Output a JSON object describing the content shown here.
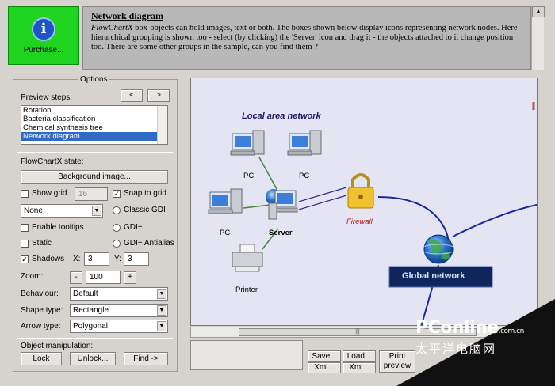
{
  "purchase": {
    "label": "Purchase...",
    "icon": "info-icon"
  },
  "description": {
    "title": "Network diagram",
    "brand": "FlowChartX",
    "text": "box-objects can hold images, text or both. The boxes shown below display icons representing network nodes. Here hierarchical grouping is shown too - select (by clicking) the 'Server' icon and drag it - the objects attached to it change position too. There are some other groups in the sample, can you find them ?"
  },
  "options": {
    "title": "Options",
    "preview_steps_label": "Preview steps:",
    "prev_label": "<",
    "next_label": ">",
    "steps": [
      "Rotation",
      "Bacteria classification",
      "Chemical synthesis tree",
      "Network diagram"
    ],
    "selected_step": "Network diagram",
    "state_label": "FlowChartX state:",
    "background_button": "Background image...",
    "show_grid": {
      "label": "Show grid",
      "checked": false,
      "value": "16"
    },
    "snap_to_grid": {
      "label": "Snap to grid",
      "checked": true
    },
    "grid_style": "None",
    "classic_gdi": "Classic GDI",
    "enable_tooltips": {
      "label": "Enable tooltips",
      "checked": false
    },
    "gdi_plus": "GDI+",
    "static": {
      "label": "Static",
      "checked": false
    },
    "gdi_plus_antialias": "GDI+ Antialias",
    "shadows": {
      "label": "Shadows",
      "checked": true
    },
    "x_label": "X:",
    "x_value": "3",
    "y_label": "Y:",
    "y_value": "3",
    "zoom_label": "Zoom:",
    "zoom_minus": "-",
    "zoom_value": "100",
    "zoom_plus": "+",
    "behaviour_label": "Behaviour:",
    "behaviour_value": "Default",
    "shape_label": "Shape type:",
    "shape_value": "Rectangle",
    "arrow_label": "Arrow type:",
    "arrow_value": "Polygonal",
    "manip_label": "Object manipulation:",
    "lock_button": "Lock",
    "unlock_button": "Unlock...",
    "find_button": "Find ->"
  },
  "diagram": {
    "group_title": "Local area network",
    "pc1": "PC",
    "pc2": "PC",
    "pc3": "PC",
    "server": "Server",
    "printer": "Printer",
    "firewall": "Firewall",
    "global": "Global network"
  },
  "bottom": {
    "save_button": "Save...",
    "load_button": "Load...",
    "save_xml": "Xml...",
    "load_xml": "Xml...",
    "print_line1": "Print",
    "print_line2": "preview"
  },
  "watermark": {
    "logo": "PConline",
    "suffix": ".com.cn",
    "sub": "太平洋电脑网"
  }
}
